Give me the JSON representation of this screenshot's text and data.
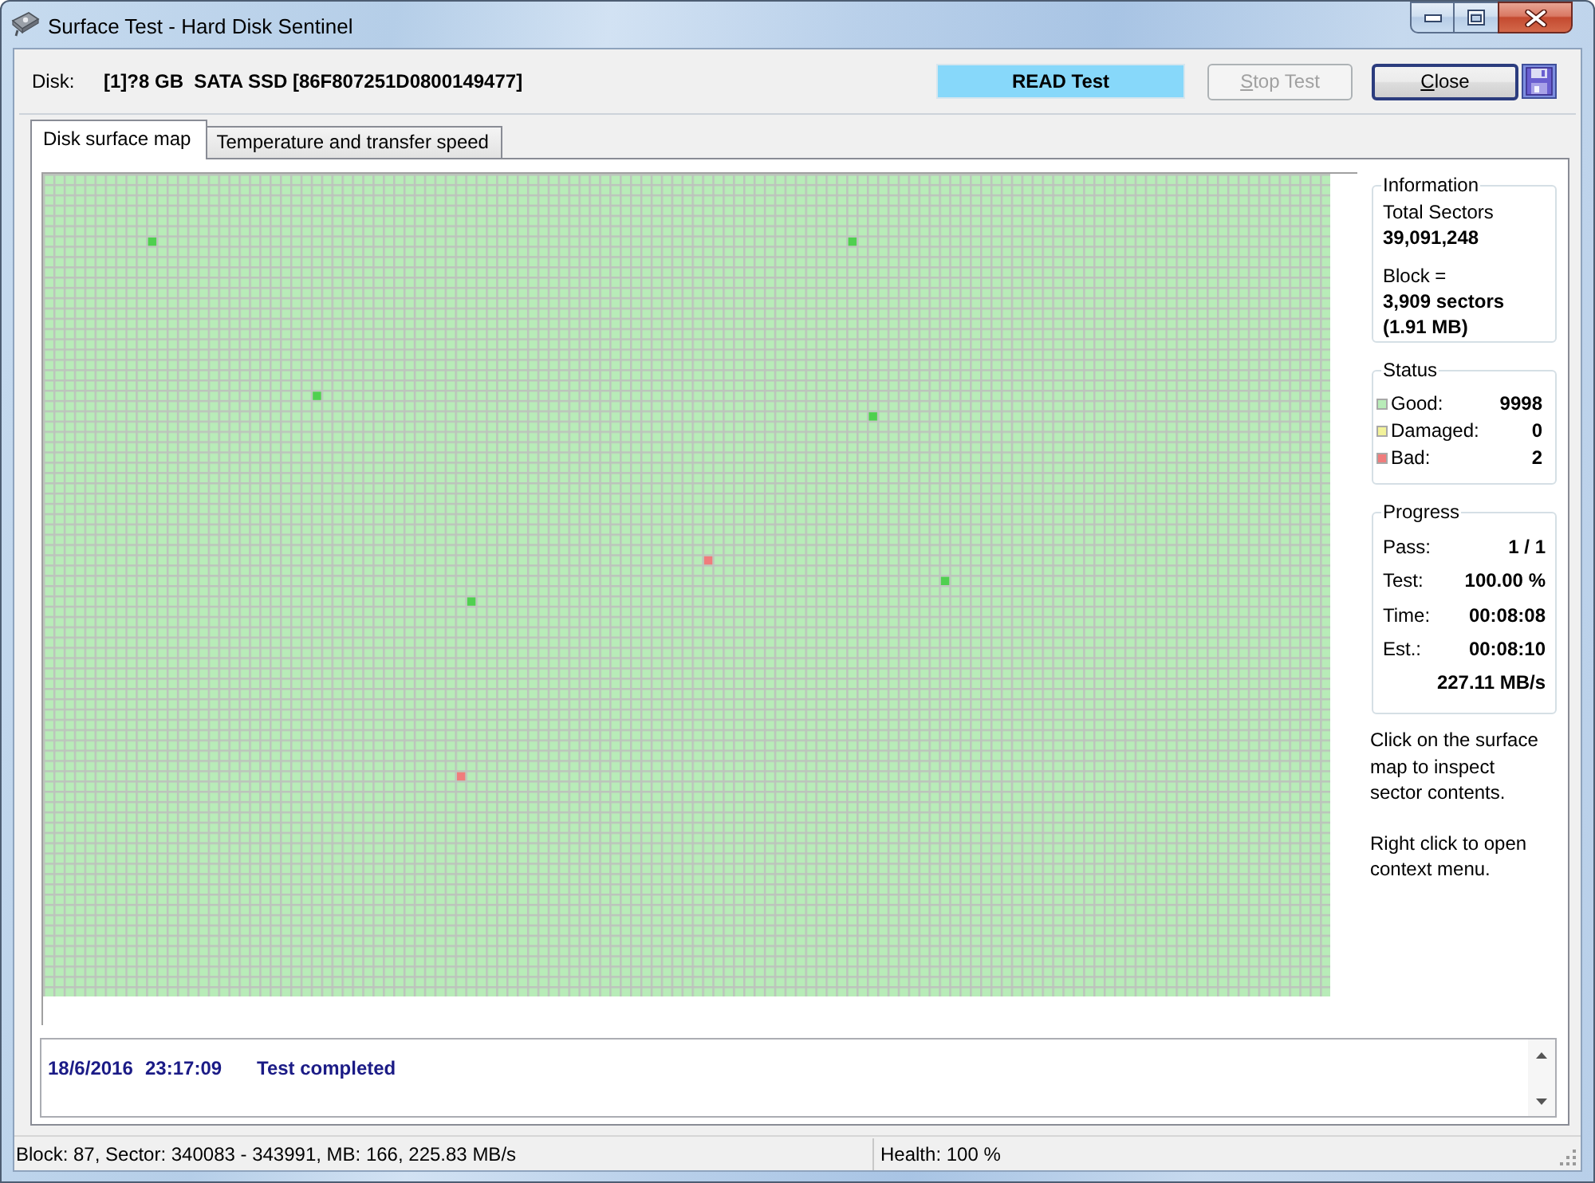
{
  "window": {
    "title": "Surface Test - Hard Disk Sentinel"
  },
  "toolbar": {
    "disk_label": "Disk:",
    "disk": "[1]?8 GB  SATA SSD [86F807251D0800149477]",
    "test_mode": "READ Test",
    "buttons": [
      {
        "label": "Stop Test",
        "disabled": true,
        "focused": false
      },
      {
        "label": "Close",
        "disabled": false,
        "focused": true
      }
    ]
  },
  "tabs": [
    {
      "label": "Disk surface map",
      "selected": true
    },
    {
      "label": "Temperature and transfer speed",
      "selected": false
    }
  ],
  "information": {
    "title": "Information",
    "total_sectors_label": "Total Sectors",
    "total_sectors": "39,091,248",
    "block_label": "Block =",
    "block_sectors": "3,909 sectors",
    "block_size": "(1.91 MB)"
  },
  "status": {
    "title": "Status",
    "items": [
      {
        "label": "Good:",
        "value": "9998",
        "color": "#b8ecb8"
      },
      {
        "label": "Damaged:",
        "value": "0",
        "color": "#f2f29a"
      },
      {
        "label": "Bad:",
        "value": "2",
        "color": "#f07c7c"
      }
    ]
  },
  "progress": {
    "title": "Progress",
    "rows": [
      {
        "label": "Pass:",
        "value": "1 / 1"
      },
      {
        "label": "Test:",
        "value": "100.00 %"
      },
      {
        "label": "Time:",
        "value": "00:08:08"
      },
      {
        "label": "Est.:",
        "value": "00:08:10"
      }
    ],
    "speed": "227.11 MB/s"
  },
  "hints": [
    "Click on the surface map to inspect sector contents.",
    "Right click to open context menu."
  ],
  "log": {
    "entries": [
      {
        "date": "18/6/2016",
        "time": "23:17:09",
        "message": "Test completed"
      }
    ]
  },
  "status_bar": {
    "block_info": "Block: 87, Sector: 340083 - 343991, MB: 166, 225.83 MB/s",
    "health": "Health: 100 %"
  }
}
